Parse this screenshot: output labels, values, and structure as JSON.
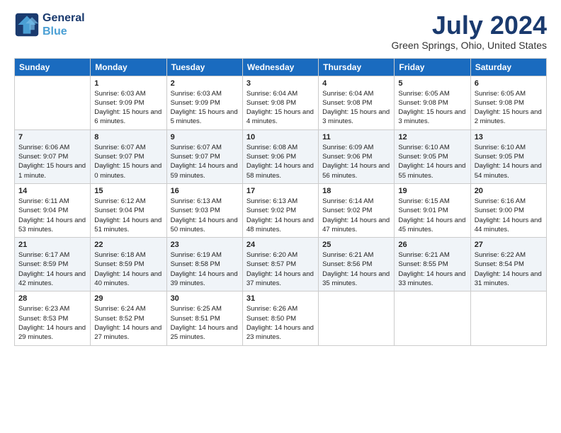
{
  "header": {
    "logo_line1": "General",
    "logo_line2": "Blue",
    "month_year": "July 2024",
    "location": "Green Springs, Ohio, United States"
  },
  "weekdays": [
    "Sunday",
    "Monday",
    "Tuesday",
    "Wednesday",
    "Thursday",
    "Friday",
    "Saturday"
  ],
  "weeks": [
    [
      {
        "day": "",
        "sunrise": "",
        "sunset": "",
        "daylight": ""
      },
      {
        "day": "1",
        "sunrise": "Sunrise: 6:03 AM",
        "sunset": "Sunset: 9:09 PM",
        "daylight": "Daylight: 15 hours and 6 minutes."
      },
      {
        "day": "2",
        "sunrise": "Sunrise: 6:03 AM",
        "sunset": "Sunset: 9:09 PM",
        "daylight": "Daylight: 15 hours and 5 minutes."
      },
      {
        "day": "3",
        "sunrise": "Sunrise: 6:04 AM",
        "sunset": "Sunset: 9:08 PM",
        "daylight": "Daylight: 15 hours and 4 minutes."
      },
      {
        "day": "4",
        "sunrise": "Sunrise: 6:04 AM",
        "sunset": "Sunset: 9:08 PM",
        "daylight": "Daylight: 15 hours and 3 minutes."
      },
      {
        "day": "5",
        "sunrise": "Sunrise: 6:05 AM",
        "sunset": "Sunset: 9:08 PM",
        "daylight": "Daylight: 15 hours and 3 minutes."
      },
      {
        "day": "6",
        "sunrise": "Sunrise: 6:05 AM",
        "sunset": "Sunset: 9:08 PM",
        "daylight": "Daylight: 15 hours and 2 minutes."
      }
    ],
    [
      {
        "day": "7",
        "sunrise": "Sunrise: 6:06 AM",
        "sunset": "Sunset: 9:07 PM",
        "daylight": "Daylight: 15 hours and 1 minute."
      },
      {
        "day": "8",
        "sunrise": "Sunrise: 6:07 AM",
        "sunset": "Sunset: 9:07 PM",
        "daylight": "Daylight: 15 hours and 0 minutes."
      },
      {
        "day": "9",
        "sunrise": "Sunrise: 6:07 AM",
        "sunset": "Sunset: 9:07 PM",
        "daylight": "Daylight: 14 hours and 59 minutes."
      },
      {
        "day": "10",
        "sunrise": "Sunrise: 6:08 AM",
        "sunset": "Sunset: 9:06 PM",
        "daylight": "Daylight: 14 hours and 58 minutes."
      },
      {
        "day": "11",
        "sunrise": "Sunrise: 6:09 AM",
        "sunset": "Sunset: 9:06 PM",
        "daylight": "Daylight: 14 hours and 56 minutes."
      },
      {
        "day": "12",
        "sunrise": "Sunrise: 6:10 AM",
        "sunset": "Sunset: 9:05 PM",
        "daylight": "Daylight: 14 hours and 55 minutes."
      },
      {
        "day": "13",
        "sunrise": "Sunrise: 6:10 AM",
        "sunset": "Sunset: 9:05 PM",
        "daylight": "Daylight: 14 hours and 54 minutes."
      }
    ],
    [
      {
        "day": "14",
        "sunrise": "Sunrise: 6:11 AM",
        "sunset": "Sunset: 9:04 PM",
        "daylight": "Daylight: 14 hours and 53 minutes."
      },
      {
        "day": "15",
        "sunrise": "Sunrise: 6:12 AM",
        "sunset": "Sunset: 9:04 PM",
        "daylight": "Daylight: 14 hours and 51 minutes."
      },
      {
        "day": "16",
        "sunrise": "Sunrise: 6:13 AM",
        "sunset": "Sunset: 9:03 PM",
        "daylight": "Daylight: 14 hours and 50 minutes."
      },
      {
        "day": "17",
        "sunrise": "Sunrise: 6:13 AM",
        "sunset": "Sunset: 9:02 PM",
        "daylight": "Daylight: 14 hours and 48 minutes."
      },
      {
        "day": "18",
        "sunrise": "Sunrise: 6:14 AM",
        "sunset": "Sunset: 9:02 PM",
        "daylight": "Daylight: 14 hours and 47 minutes."
      },
      {
        "day": "19",
        "sunrise": "Sunrise: 6:15 AM",
        "sunset": "Sunset: 9:01 PM",
        "daylight": "Daylight: 14 hours and 45 minutes."
      },
      {
        "day": "20",
        "sunrise": "Sunrise: 6:16 AM",
        "sunset": "Sunset: 9:00 PM",
        "daylight": "Daylight: 14 hours and 44 minutes."
      }
    ],
    [
      {
        "day": "21",
        "sunrise": "Sunrise: 6:17 AM",
        "sunset": "Sunset: 8:59 PM",
        "daylight": "Daylight: 14 hours and 42 minutes."
      },
      {
        "day": "22",
        "sunrise": "Sunrise: 6:18 AM",
        "sunset": "Sunset: 8:59 PM",
        "daylight": "Daylight: 14 hours and 40 minutes."
      },
      {
        "day": "23",
        "sunrise": "Sunrise: 6:19 AM",
        "sunset": "Sunset: 8:58 PM",
        "daylight": "Daylight: 14 hours and 39 minutes."
      },
      {
        "day": "24",
        "sunrise": "Sunrise: 6:20 AM",
        "sunset": "Sunset: 8:57 PM",
        "daylight": "Daylight: 14 hours and 37 minutes."
      },
      {
        "day": "25",
        "sunrise": "Sunrise: 6:21 AM",
        "sunset": "Sunset: 8:56 PM",
        "daylight": "Daylight: 14 hours and 35 minutes."
      },
      {
        "day": "26",
        "sunrise": "Sunrise: 6:21 AM",
        "sunset": "Sunset: 8:55 PM",
        "daylight": "Daylight: 14 hours and 33 minutes."
      },
      {
        "day": "27",
        "sunrise": "Sunrise: 6:22 AM",
        "sunset": "Sunset: 8:54 PM",
        "daylight": "Daylight: 14 hours and 31 minutes."
      }
    ],
    [
      {
        "day": "28",
        "sunrise": "Sunrise: 6:23 AM",
        "sunset": "Sunset: 8:53 PM",
        "daylight": "Daylight: 14 hours and 29 minutes."
      },
      {
        "day": "29",
        "sunrise": "Sunrise: 6:24 AM",
        "sunset": "Sunset: 8:52 PM",
        "daylight": "Daylight: 14 hours and 27 minutes."
      },
      {
        "day": "30",
        "sunrise": "Sunrise: 6:25 AM",
        "sunset": "Sunset: 8:51 PM",
        "daylight": "Daylight: 14 hours and 25 minutes."
      },
      {
        "day": "31",
        "sunrise": "Sunrise: 6:26 AM",
        "sunset": "Sunset: 8:50 PM",
        "daylight": "Daylight: 14 hours and 23 minutes."
      },
      {
        "day": "",
        "sunrise": "",
        "sunset": "",
        "daylight": ""
      },
      {
        "day": "",
        "sunrise": "",
        "sunset": "",
        "daylight": ""
      },
      {
        "day": "",
        "sunrise": "",
        "sunset": "",
        "daylight": ""
      }
    ]
  ]
}
